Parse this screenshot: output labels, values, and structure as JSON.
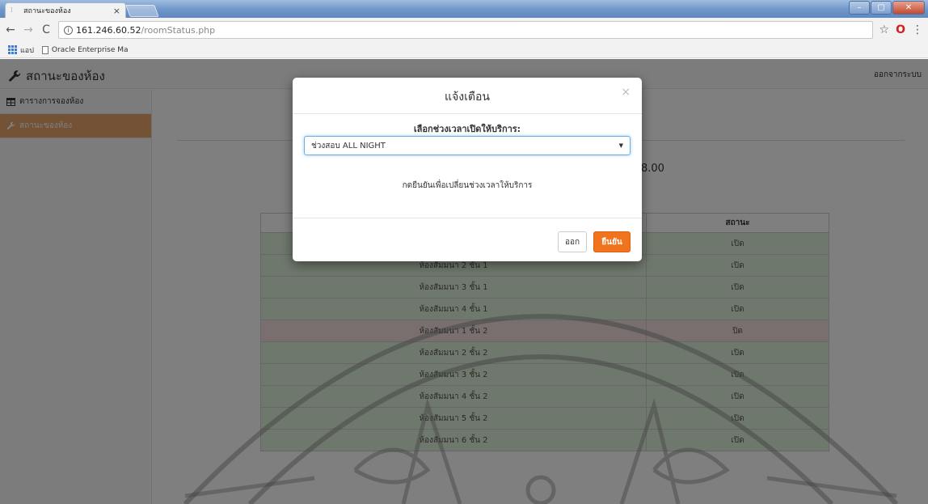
{
  "browser": {
    "tab_title": "สถานะของห้อง",
    "tab_close": "×",
    "url_host": "161.246.60.52",
    "url_path": "/roomStatus.php",
    "bookmarks": {
      "apps_label": "แอป",
      "item1": "Oracle Enterprise Ma"
    },
    "icons": {
      "back": "←",
      "forward": "→",
      "reload": "C",
      "star": "☆",
      "opera": "O",
      "menu": "⋮"
    },
    "window_controls": {
      "minimize": "–",
      "maximize": "▢",
      "close": "✕"
    }
  },
  "navbar": {
    "brand": "สถานะของห้อง",
    "logout": "ออกจากระบบ"
  },
  "sidebar": {
    "items": [
      {
        "label": "ตารางการจองห้อง",
        "icon": "table-icon"
      },
      {
        "label": "สถานะของห้อง",
        "icon": "wrench-icon"
      }
    ]
  },
  "main": {
    "time_text": "8.00",
    "table": {
      "headers": [
        "",
        "สถานะ"
      ],
      "rows": [
        {
          "name": "",
          "status": "เปิด"
        },
        {
          "name": "ห้องสัมมนา 2 ชั้น 1",
          "status": "เปิด"
        },
        {
          "name": "ห้องสัมมนา 3 ชั้น 1",
          "status": "เปิด"
        },
        {
          "name": "ห้องสัมมนา 4 ชั้น 1",
          "status": "เปิด"
        },
        {
          "name": "ห้องสัมมนา 1 ชั้น 2",
          "status": "ปิด"
        },
        {
          "name": "ห้องสัมมนา 2 ชั้น 2",
          "status": "เปิด"
        },
        {
          "name": "ห้องสัมมนา 3 ชั้น 2",
          "status": "เปิด"
        },
        {
          "name": "ห้องสัมมนา 4 ชั้น 2",
          "status": "เปิด"
        },
        {
          "name": "ห้องสัมมนา 5 ชั้น 2",
          "status": "เปิด"
        },
        {
          "name": "ห้องสัมมนา 6 ชั้น 2",
          "status": "เปิด"
        }
      ]
    }
  },
  "modal": {
    "title": "แจ้งเตือน",
    "close": "×",
    "field_label": "เลือกช่วงเวลาเปิดให้บริการ:",
    "select_value": "ช่วงสอบ ALL NIGHT",
    "note": "กดยืนยันเพื่อเปลี่ยนช่วงเวลาให้บริการ",
    "exit_label": "ออก",
    "confirm_label": "ยืนยัน"
  },
  "colors": {
    "accent": "#f0731e",
    "sidebar_active": "#e8a56d",
    "row_open": "#dff0d8",
    "row_closed": "#f2dede"
  }
}
